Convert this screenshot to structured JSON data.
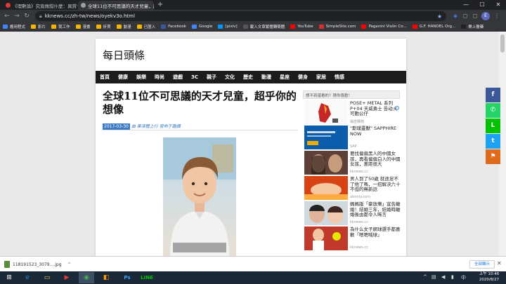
{
  "browser": {
    "tabs": [
      {
        "title": "《理數論》究竟做錯什麼：異質性..."
      },
      {
        "title": "全球11位不可思議的天才兒童，超..."
      }
    ],
    "new_tab": "+",
    "window_controls": {
      "minimize": "—",
      "maximize": "☐",
      "close": "✕"
    },
    "url": "kknews.cc/zh-tw/news/oyekv3o.html",
    "bookmarks": [
      {
        "label": "應用程式",
        "color": "#4285f4"
      },
      {
        "label": "影片",
        "color": "#f4b400"
      },
      {
        "label": "我工作",
        "color": "#f4b400"
      },
      {
        "label": "漫畫",
        "color": "#f4b400"
      },
      {
        "label": "折買",
        "color": "#f4b400"
      },
      {
        "label": "動漫",
        "color": "#f4b400"
      },
      {
        "label": "已匯入",
        "color": "#f4b400"
      },
      {
        "label": "Facebook",
        "color": "#3b5998"
      },
      {
        "label": "Google",
        "color": "#4285f4"
      },
      {
        "label": "[pixiv]",
        "color": "#0096fa"
      },
      {
        "label": "載入文章繁體轉簡體",
        "color": "#555555"
      },
      {
        "label": "YouTube",
        "color": "#ff0000"
      },
      {
        "label": "SimpleSite.com",
        "color": "#d32f2f"
      },
      {
        "label": "Paganini Violin Co...",
        "color": "#ff0000"
      },
      {
        "label": "G.F. HANDEL Org...",
        "color": "#ff0000"
      },
      {
        "label": "樂上醫藥",
        "color": "#222222"
      }
    ]
  },
  "site": {
    "title": "每日頭條",
    "nav": [
      "首頁",
      "健康",
      "娛樂",
      "時尚",
      "遊戲",
      "3C",
      "親子",
      "文化",
      "歷史",
      "動漫",
      "星座",
      "健身",
      "家居",
      "情感"
    ]
  },
  "article": {
    "headline": "全球11位不可思議的天才兒童，超乎你的想像",
    "date": "2017-03-30",
    "source": "由 果凍體上行 發佈于趣讀"
  },
  "sidebar": {
    "header": "想不到還看的？猜你喜歡！",
    "ad_badge": "i",
    "items": [
      {
        "title": "POSE+ METAL 系列 P+04 天威勇士 告动火 可動公仔",
        "source": "蝦皮購物"
      },
      {
        "title": "\"斯璞靈獸\" SAPPHIRE NOW",
        "source": "SAP"
      },
      {
        "title": "要找偏偏黑人的中國女孩，再看偏偏白人的中國女孩，差距很大",
        "source": "kknews.cc"
      },
      {
        "title": "男人到了50歲 就逐足不了他了嗎，一招解決六十不但的無新話",
        "source": "abnoty.com"
      },
      {
        "title": "媽媽版「豪放樂」宣告離婚！結婚三年，結婚時離婚後由都令人唏言",
        "source": "kknews.cc"
      },
      {
        "title": "為什么女子網球選手都喜歡「嗯嗯喊球」",
        "source": "kknews.cc"
      }
    ]
  },
  "share_buttons": [
    {
      "name": "facebook",
      "glyph": "f",
      "color": "#3b5998"
    },
    {
      "name": "whatsapp",
      "glyph": "✆",
      "color": "#25d366"
    },
    {
      "name": "line",
      "glyph": "L",
      "color": "#00c300"
    },
    {
      "name": "twitter",
      "glyph": "t",
      "color": "#1da1f2"
    },
    {
      "name": "flag",
      "glyph": "⚑",
      "color": "#e06a1c"
    }
  ],
  "downloads": {
    "file": "118191523_3079....jpg",
    "show_all": "全部顯示"
  },
  "taskbar": {
    "time": "上午 10:46",
    "date": "2020/8/27"
  }
}
